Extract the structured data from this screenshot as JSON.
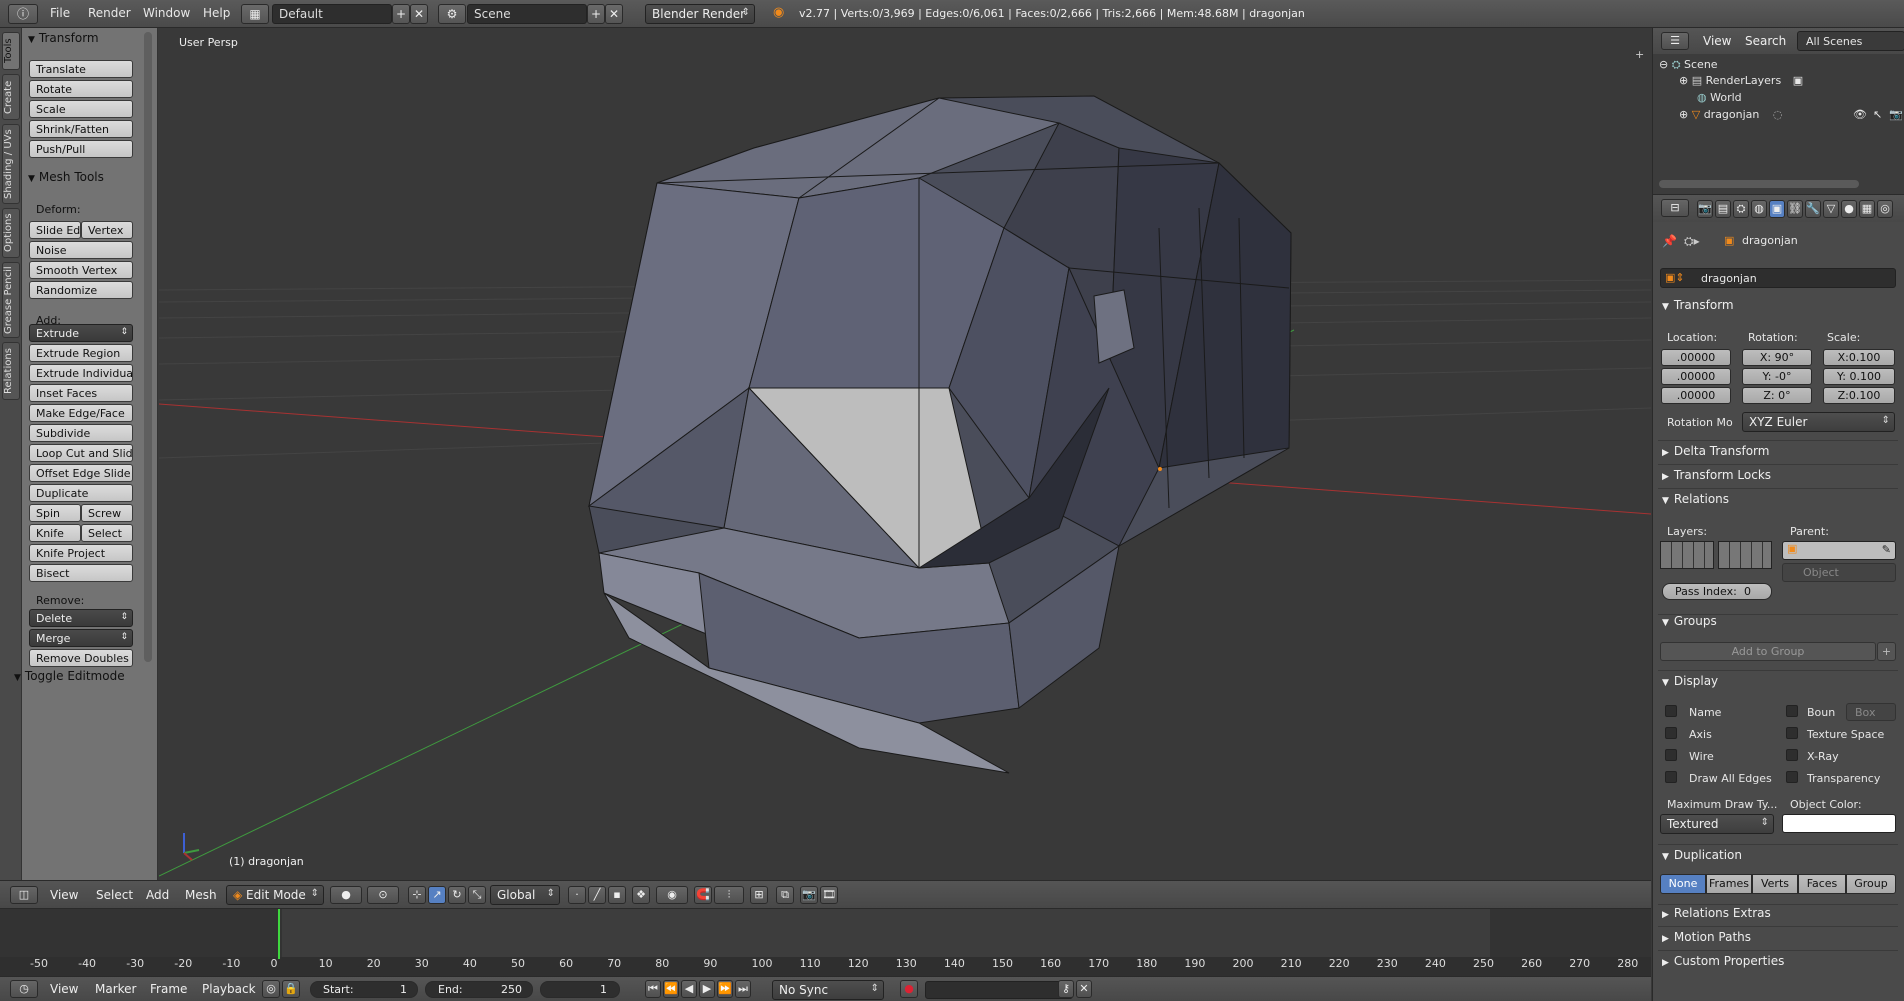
{
  "topbar": {
    "menus": [
      "File",
      "Render",
      "Window",
      "Help"
    ],
    "screen_layout": "Default",
    "scene": "Scene",
    "engine": "Blender Render",
    "stats": "v2.77 | Verts:0/3,969 | Edges:0/6,061 | Faces:0/2,666 | Tris:2,666 | Mem:48.68M | dragonjan"
  },
  "tooltabs": [
    "Tools",
    "Create",
    "Shading / UVs",
    "Options",
    "Grease Pencil",
    "Relations"
  ],
  "tools": {
    "transform_header": "Transform",
    "transform_buttons": [
      "Translate",
      "Rotate",
      "Scale",
      "Shrink/Fatten",
      "Push/Pull"
    ],
    "mesh_tools_header": "Mesh Tools",
    "deform_label": "Deform:",
    "slide_edge": "Slide Ed",
    "vertex": "Vertex",
    "noise": "Noise",
    "smooth_vertex": "Smooth Vertex",
    "randomize": "Randomize",
    "add_label": "Add:",
    "extrude": "Extrude",
    "add_buttons": [
      "Extrude Region",
      "Extrude Individual",
      "Inset Faces",
      "Make Edge/Face",
      "Subdivide",
      "Loop Cut and Slide",
      "Offset Edge Slide",
      "Duplicate"
    ],
    "spin": "Spin",
    "screw": "Screw",
    "knife": "Knife",
    "select": "Select",
    "knife_project": "Knife Project",
    "bisect": "Bisect",
    "remove_label": "Remove:",
    "delete": "Delete",
    "merge": "Merge",
    "remove_doubles": "Remove Doubles",
    "toggle_editmode": "Toggle Editmode"
  },
  "viewport": {
    "view_label": "User Persp",
    "object_label": "(1) dragonjan"
  },
  "view3d_header": {
    "menus": [
      "View",
      "Select",
      "Add",
      "Mesh"
    ],
    "mode": "Edit Mode",
    "orientation": "Global"
  },
  "timeline": {
    "ticks": [
      "-50",
      "-40",
      "-30",
      "-20",
      "-10",
      "0",
      "10",
      "20",
      "30",
      "40",
      "50",
      "60",
      "70",
      "80",
      "90",
      "100",
      "110",
      "120",
      "130",
      "140",
      "150",
      "160",
      "170",
      "180",
      "190",
      "200",
      "210",
      "220",
      "230",
      "240",
      "250",
      "260",
      "270",
      "280"
    ],
    "current_frame_value": 0,
    "menus": [
      "View",
      "Marker",
      "Frame",
      "Playback"
    ],
    "start_label": "Start:",
    "start": "1",
    "end_label": "End:",
    "end": "250",
    "frame": "1",
    "sync": "No Sync"
  },
  "outliner": {
    "menus": [
      "View",
      "Search"
    ],
    "filter": "All Scenes",
    "items": [
      "Scene",
      "RenderLayers",
      "World",
      "dragonjan"
    ]
  },
  "properties": {
    "object_path": "dragonjan",
    "object_name": "dragonjan",
    "transform": "Transform",
    "location_label": "Location:",
    "rotation_label": "Rotation:",
    "scale_label": "Scale:",
    "location": [
      ".00000",
      ".00000",
      ".00000"
    ],
    "rotation": [
      "X:",
      "90°",
      "Y:",
      "-0°",
      "Z:",
      "0°"
    ],
    "scale": [
      "X:0.100",
      "Y: 0.100",
      "Z:0.100"
    ],
    "rotation_mode_label": "Rotation Mo",
    "rotation_mode": "XYZ Euler",
    "delta_transform": "Delta Transform",
    "transform_locks": "Transform Locks",
    "relations": "Relations",
    "layers_label": "Layers:",
    "parent_label": "Parent:",
    "parent_type": "Object",
    "pass_index_label": "Pass Index:",
    "pass_index": "0",
    "groups": "Groups",
    "add_to_group": "Add to Group",
    "display": "Display",
    "display_left": [
      "Name",
      "Axis",
      "Wire",
      "Draw All Edges"
    ],
    "display_right": [
      "Boun",
      "Texture Space",
      "X-Ray",
      "Transparency"
    ],
    "bounds_type": "Box",
    "max_draw_label": "Maximum Draw Ty...",
    "object_color_label": "Object Color:",
    "max_draw_type": "Textured",
    "duplication": "Duplication",
    "dup_options": [
      "None",
      "Frames",
      "Verts",
      "Faces",
      "Group"
    ],
    "relations_extras": "Relations Extras",
    "motion_paths": "Motion Paths",
    "custom_properties": "Custom Properties"
  },
  "colors": {
    "viewport_bg": "#393939",
    "mesh_face": "#5d6070",
    "active_blue": "#5680c2",
    "x_axis": "#a83232",
    "y_axis": "#3f9a3f",
    "playhead": "#3fd73f"
  }
}
